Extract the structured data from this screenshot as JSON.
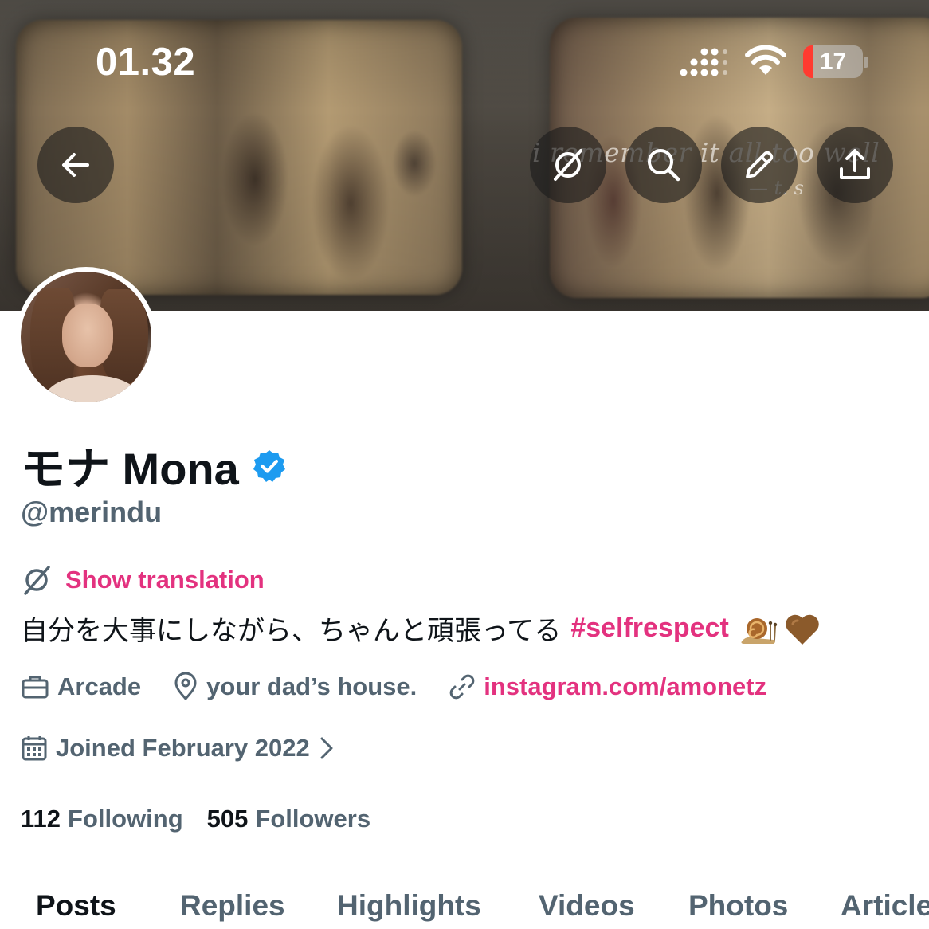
{
  "status_bar": {
    "time": "01.32",
    "battery_level": "17",
    "battery_fraction": 0.17
  },
  "banner": {
    "quote": "i remember it all too well",
    "quote_signature": "— t. s"
  },
  "banner_buttons": {
    "back_icon": "arrow-left-icon",
    "translate_icon": "translate-slash-icon",
    "search_icon": "search-icon",
    "edit_icon": "pencil-icon",
    "share_icon": "share-icon"
  },
  "profile": {
    "display_name": "モナ Mona",
    "verified": true,
    "handle": "@merindu",
    "translate_label": "Show translation",
    "bio_text": "自分を大事にしながら、ちゃんと頑張ってる",
    "bio_hashtag": "#selfrespect",
    "bio_emojis": [
      "snail-emoji",
      "brown-heart-emoji"
    ],
    "category": "Arcade",
    "location": "your dad’s house.",
    "website": "instagram.com/amonetz",
    "joined": "Joined February 2022",
    "following_count": "112",
    "following_label": "Following",
    "followers_count": "505",
    "followers_label": "Followers"
  },
  "tabs": [
    {
      "label": "Posts",
      "active": true
    },
    {
      "label": "Replies",
      "active": false
    },
    {
      "label": "Highlights",
      "active": false
    },
    {
      "label": "Videos",
      "active": false
    },
    {
      "label": "Photos",
      "active": false
    },
    {
      "label": "Articles",
      "active": false
    }
  ],
  "colors": {
    "accent": "#e3327f",
    "verified": "#1d9bf0",
    "secondary_text": "#536471",
    "primary_text": "#0f1419"
  }
}
